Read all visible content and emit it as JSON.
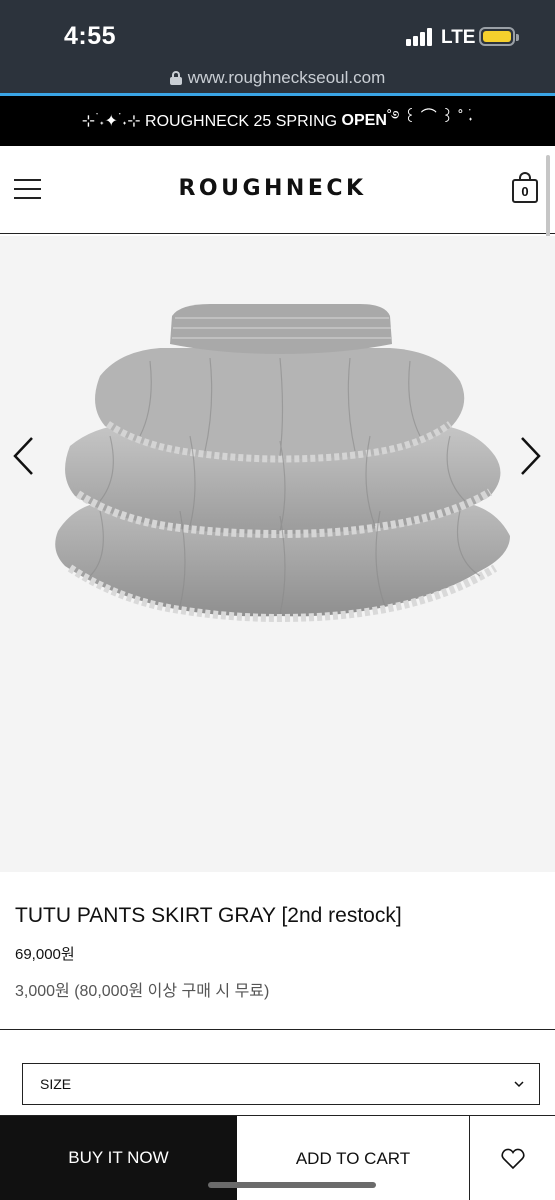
{
  "status_bar": {
    "time": "4:55",
    "network": "LTE",
    "battery_color": "#f5d02d"
  },
  "browser": {
    "url": "www.roughneckseoul.com",
    "progress_color": "#3aa5e6"
  },
  "announcement": {
    "prefix": "⊹ ࣪˖✦ ࣪˖⊹ ROUGHNECK 25 SPRING ",
    "highlight": "OPEN",
    "suffix": "˚࿔ ꒰ ⌒ ꒱ ˚ ࣪˖"
  },
  "header": {
    "logo": "ROUGHNECK",
    "cart_count": "0"
  },
  "gallery": {
    "image_alt": "TUTU PANTS SKIRT GRAY",
    "prev_icon": "chevron-left-icon",
    "next_icon": "chevron-right-icon"
  },
  "product": {
    "title": "TUTU PANTS SKIRT GRAY [2nd restock]",
    "price": "69,000원",
    "shipping": "3,000원 (80,000원 이상 구매 시 무료)"
  },
  "options": {
    "size_label": "SIZE"
  },
  "actions": {
    "buy_now": "BUY IT NOW",
    "add_to_cart": "ADD TO CART",
    "wishlist_icon": "heart-icon"
  }
}
